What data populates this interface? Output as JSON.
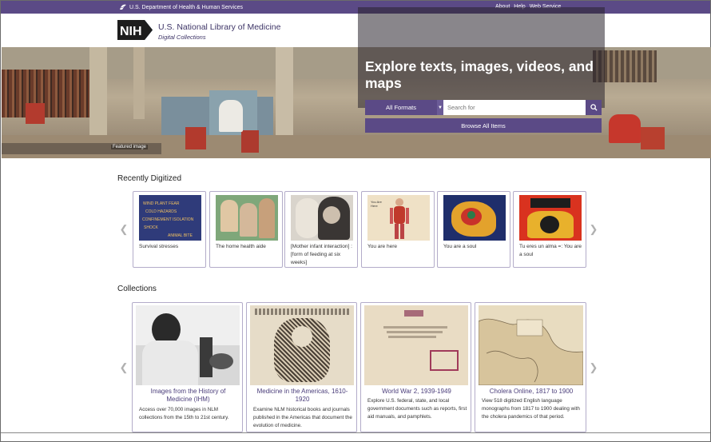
{
  "topbar": {
    "agency": "U.S. Department of Health & Human Services",
    "links": [
      "About",
      "Help",
      "Web Service"
    ]
  },
  "header": {
    "logo_text": "NIH",
    "title": "U.S. National Library of Medicine",
    "subtitle": "Digital Collections"
  },
  "hero": {
    "title": "Explore texts, images, videos, and maps",
    "formats_label": "All Formats",
    "search_placeholder": "Search for",
    "browse_label": "Browse All Items",
    "featured_label": "Featured image"
  },
  "recently_digitized": {
    "heading": "Recently Digitized",
    "items": [
      {
        "caption": "Survival stresses",
        "icon": "poster-words-image"
      },
      {
        "caption": "The home health aide",
        "icon": "photo-people-image"
      },
      {
        "caption": "[Mother infant interaction] : [form of feeding at six weeks]",
        "icon": "photo-mother-infant-image"
      },
      {
        "caption": "You are here",
        "icon": "anatomy-poster-image"
      },
      {
        "caption": "You are a soul",
        "icon": "colorful-poster-image"
      },
      {
        "caption": "Tu eres un alma =: You are a soul",
        "icon": "red-poster-image"
      }
    ]
  },
  "collections": {
    "heading": "Collections",
    "items": [
      {
        "title": "Images from the History of Medicine (IHM)",
        "description": "Access over 70,000 images in NLM collections from the 15th to 21st century."
      },
      {
        "title": "Medicine in the Americas, 1610-1920",
        "description": "Examine NLM historical books and journals published in the Americas that document the evolution of medicine."
      },
      {
        "title": "World War 2, 1939-1949",
        "description": "Explore U.S. federal, state, and local government documents such as reports, first aid manuals, and pamphlets."
      },
      {
        "title": "Cholera Online, 1817 to 1900",
        "description": "View 518 digitized English language monographs from 1817 to 1900 dealing with the cholera pandemics of that period."
      }
    ]
  },
  "colors": {
    "brand_purple": "#5b4a86",
    "card_border": "#b3acc9"
  }
}
